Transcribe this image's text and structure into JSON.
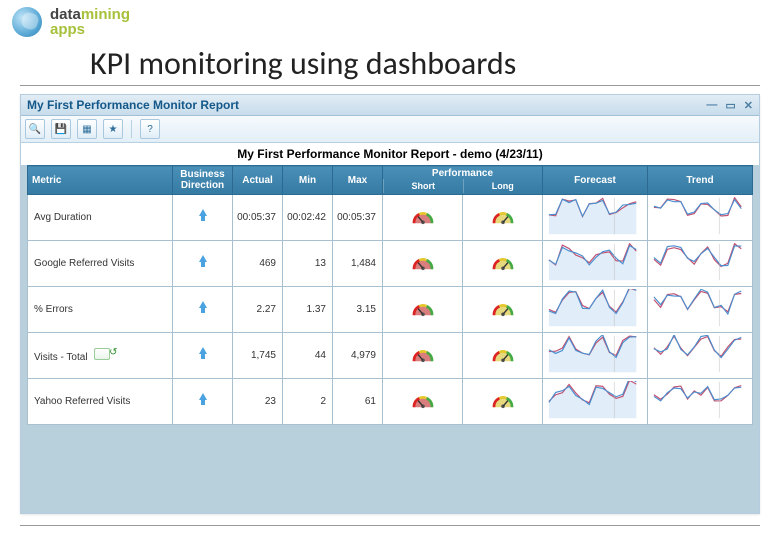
{
  "brand": {
    "line1_a": "data",
    "line1_b": "mining",
    "line2": "apps"
  },
  "page": {
    "title": "KPI monitoring using dashboards"
  },
  "window": {
    "title": "My First Performance Monitor Report"
  },
  "report": {
    "title": "My First Performance Monitor Report - demo (4/23/11)"
  },
  "headers": {
    "metric": "Metric",
    "direction": "Business Direction",
    "actual": "Actual",
    "min": "Min",
    "max": "Max",
    "performance": "Performance",
    "perf_short": "Short",
    "perf_long": "Long",
    "forecast": "Forecast",
    "trend": "Trend"
  },
  "rows": [
    {
      "metric": "Avg Duration",
      "actual": "00:05:37",
      "min": "00:02:42",
      "max": "00:05:37",
      "has_icon": false
    },
    {
      "metric": "Google Referred Visits",
      "actual": "469",
      "min": "13",
      "max": "1,484",
      "has_icon": false
    },
    {
      "metric": "% Errors",
      "actual": "2.27",
      "min": "1.37",
      "max": "3.15",
      "has_icon": false
    },
    {
      "metric": "Visits - Total",
      "actual": "1,745",
      "min": "44",
      "max": "4,979",
      "has_icon": true
    },
    {
      "metric": "Yahoo Referred Visits",
      "actual": "23",
      "min": "2",
      "max": "61",
      "has_icon": false
    }
  ],
  "toolbar_icons": [
    "zoom-icon",
    "save-icon",
    "grid-icon",
    "favorite-icon",
    "help-icon"
  ]
}
